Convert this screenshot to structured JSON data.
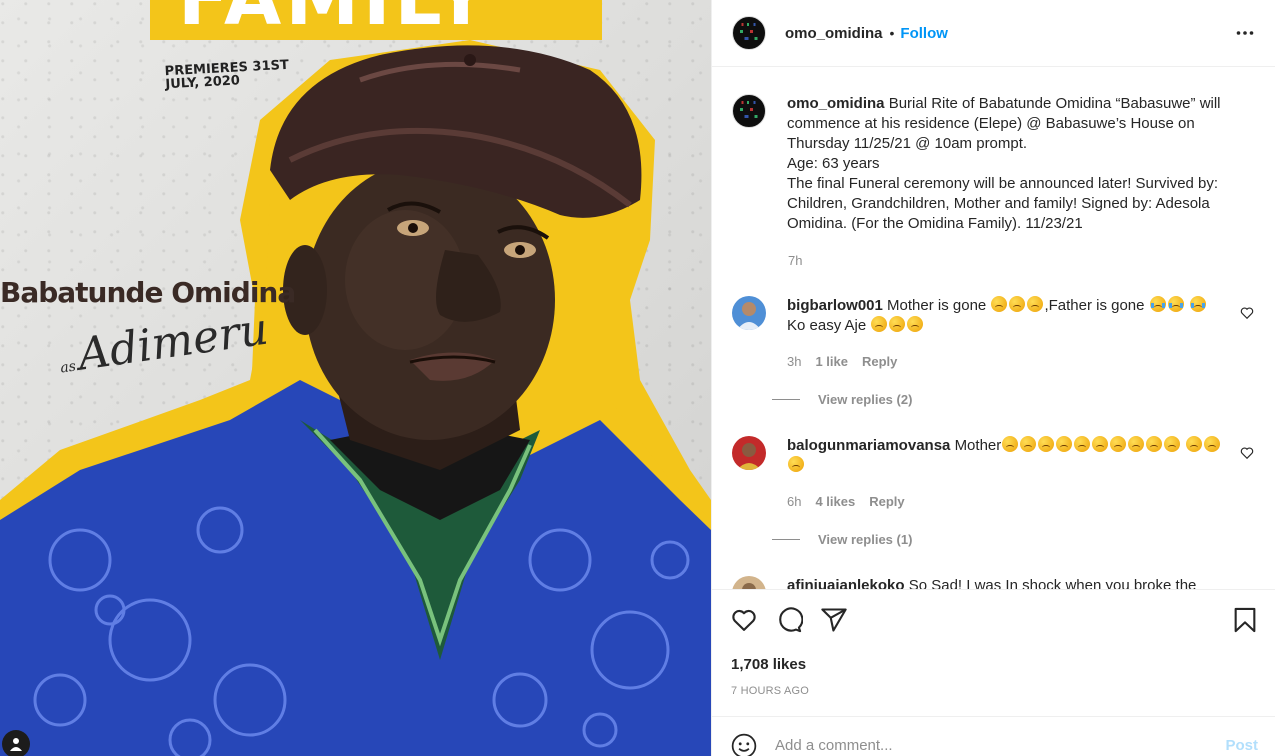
{
  "post_image": {
    "poster_title": "FAMILY",
    "premieres": "PREMIERES 31ST\nJULY, 2020",
    "actor_name": "Babatunde Omidina",
    "role_prefix": "as",
    "role_name": "Adimeru",
    "accent_color": "#f3c51a"
  },
  "header": {
    "username": "omo_omidina",
    "dot": "•",
    "follow_label": "Follow",
    "more_icon": "more-horizontal-icon"
  },
  "caption": {
    "username": "omo_omidina",
    "text_1": "Burial Rite of Babatunde Omidina “Babasuwe” will commence at his residence (Elepe) @ Babasuwe’s House on Thursday 11/25/21 @ 10am prompt.",
    "text_2": "Age: 63 years",
    "text_3": "The final Funeral ceremony will be announced later! Survived by: Children, Grandchildren, Mother and family! Signed by: Adesola Omidina. (For the Omidina Family). 11/23/21",
    "time": "7h"
  },
  "comments": [
    {
      "username": "bigbarlow001",
      "text_a": "Mother is gone",
      "text_b": ",Father is gone",
      "text_c": "Ko easy Aje",
      "time": "3h",
      "likes": "1 like",
      "reply_label": "Reply",
      "view_replies": "View replies (2)"
    },
    {
      "username": "balogunmariamovansa",
      "text_a": "Mother",
      "time": "6h",
      "likes": "4 likes",
      "reply_label": "Reply",
      "view_replies": "View replies (1)"
    },
    {
      "username": "afinjuajanlekoko",
      "text_a": "So Sad! I was In shock when you broke the"
    }
  ],
  "actions": {
    "likes": "1,708 likes",
    "age": "7 HOURS AGO"
  },
  "add_comment": {
    "placeholder": "Add a comment...",
    "post_label": "Post"
  },
  "colors": {
    "link": "#0095f6",
    "post_disabled": "#b2dffc",
    "muted": "#8e8e8e"
  }
}
